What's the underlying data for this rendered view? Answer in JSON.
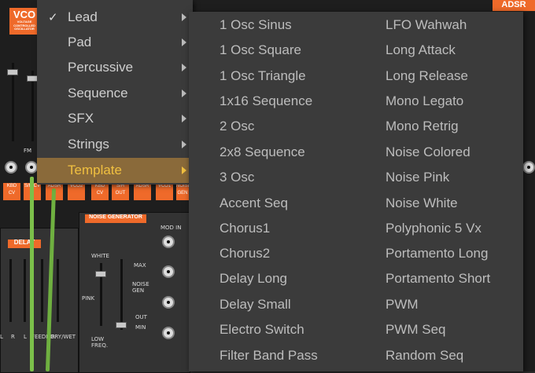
{
  "main_menu": {
    "items": [
      {
        "label": "Lead",
        "checked": true,
        "has_submenu": true,
        "selected": false
      },
      {
        "label": "Pad",
        "checked": false,
        "has_submenu": true,
        "selected": false
      },
      {
        "label": "Percussive",
        "checked": false,
        "has_submenu": true,
        "selected": false
      },
      {
        "label": "Sequence",
        "checked": false,
        "has_submenu": true,
        "selected": false
      },
      {
        "label": "SFX",
        "checked": false,
        "has_submenu": true,
        "selected": false
      },
      {
        "label": "Strings",
        "checked": false,
        "has_submenu": true,
        "selected": false
      },
      {
        "label": "Template",
        "checked": false,
        "has_submenu": true,
        "selected": true
      }
    ],
    "check_glyph": "✓"
  },
  "submenu": {
    "column1": [
      "1 Osc Sinus",
      "1 Osc Square",
      "1 Osc Triangle",
      "1x16 Sequence",
      "2 Osc",
      "2x8 Sequence",
      "3 Osc",
      "Accent Seq",
      "Chorus1",
      "Chorus2",
      "Delay Long",
      "Delay Small",
      "Electro Switch",
      "Filter Band Pass"
    ],
    "column2": [
      "LFO Wahwah",
      "Long Attack",
      "Long Release",
      "Mono Legato",
      "Mono Retrig",
      "Noise Colored",
      "Noise Pink",
      "Noise White",
      "Polyphonic 5 Vx",
      "Portamento Long",
      "Portamento Short",
      "PWM",
      "PWM Seq",
      "Random Seq"
    ]
  },
  "synth": {
    "vco_tag": "VCO",
    "vco_sub": "VOLTAGE CONTROLLED OSCILLATOR",
    "adsr_tag": "ADSR",
    "fm_label": "FM",
    "delay_tag": "DELAY",
    "noise_gen_tag": "NOISE GENERATOR",
    "noise_labels": {
      "white": "WHITE",
      "pink": "PINK",
      "low_freq": "LOW FREQ.",
      "max": "MAX",
      "noise_gen": "NOISE GEN",
      "out": "OUT",
      "min": "MIN",
      "mod_in": "MOD IN"
    },
    "bottom_buttons": [
      "KBD CV",
      "S/H CV",
      "ADSR",
      "VCO2",
      "KBD CV",
      "S/H OUT",
      "ADSR",
      "VCO1",
      "NOISE GEN"
    ],
    "delay_labels": [
      "L",
      "R",
      "L",
      "FEEDK R",
      "DRY/WET"
    ],
    "colors": {
      "accent": "#ef6a2a",
      "menu_bg": "#3b3b3b",
      "selected_bg": "#8a6a3a",
      "selected_text": "#f0c040",
      "cable": "#7cc04a"
    }
  }
}
